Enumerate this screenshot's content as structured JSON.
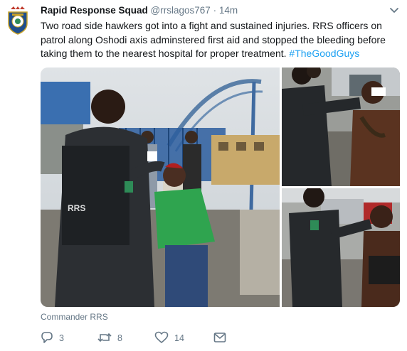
{
  "tweet": {
    "author_name": "Rapid Response Squad",
    "handle": "@rrslagos767",
    "separator": "·",
    "time": "14m",
    "text_main": "Two road side hawkers got into a fight and sustained injuries. RRS officers on patrol along Oshodi axis adminstered first aid and stopped the bleeding before taking them to the nearest hospital for proper treatment. ",
    "hashtag": "#TheGoodGuys",
    "photo_credit": "Commander RRS"
  },
  "actions": {
    "reply_count": "3",
    "retweet_count": "8",
    "like_count": "14"
  },
  "icons": {
    "avatar": "police-badge-icon",
    "menu": "chevron-down-icon",
    "reply": "reply-icon",
    "retweet": "retweet-icon",
    "like": "heart-icon",
    "dm": "envelope-icon"
  },
  "colors": {
    "link": "#1da1f2",
    "muted": "#657786",
    "text": "#14171a"
  }
}
